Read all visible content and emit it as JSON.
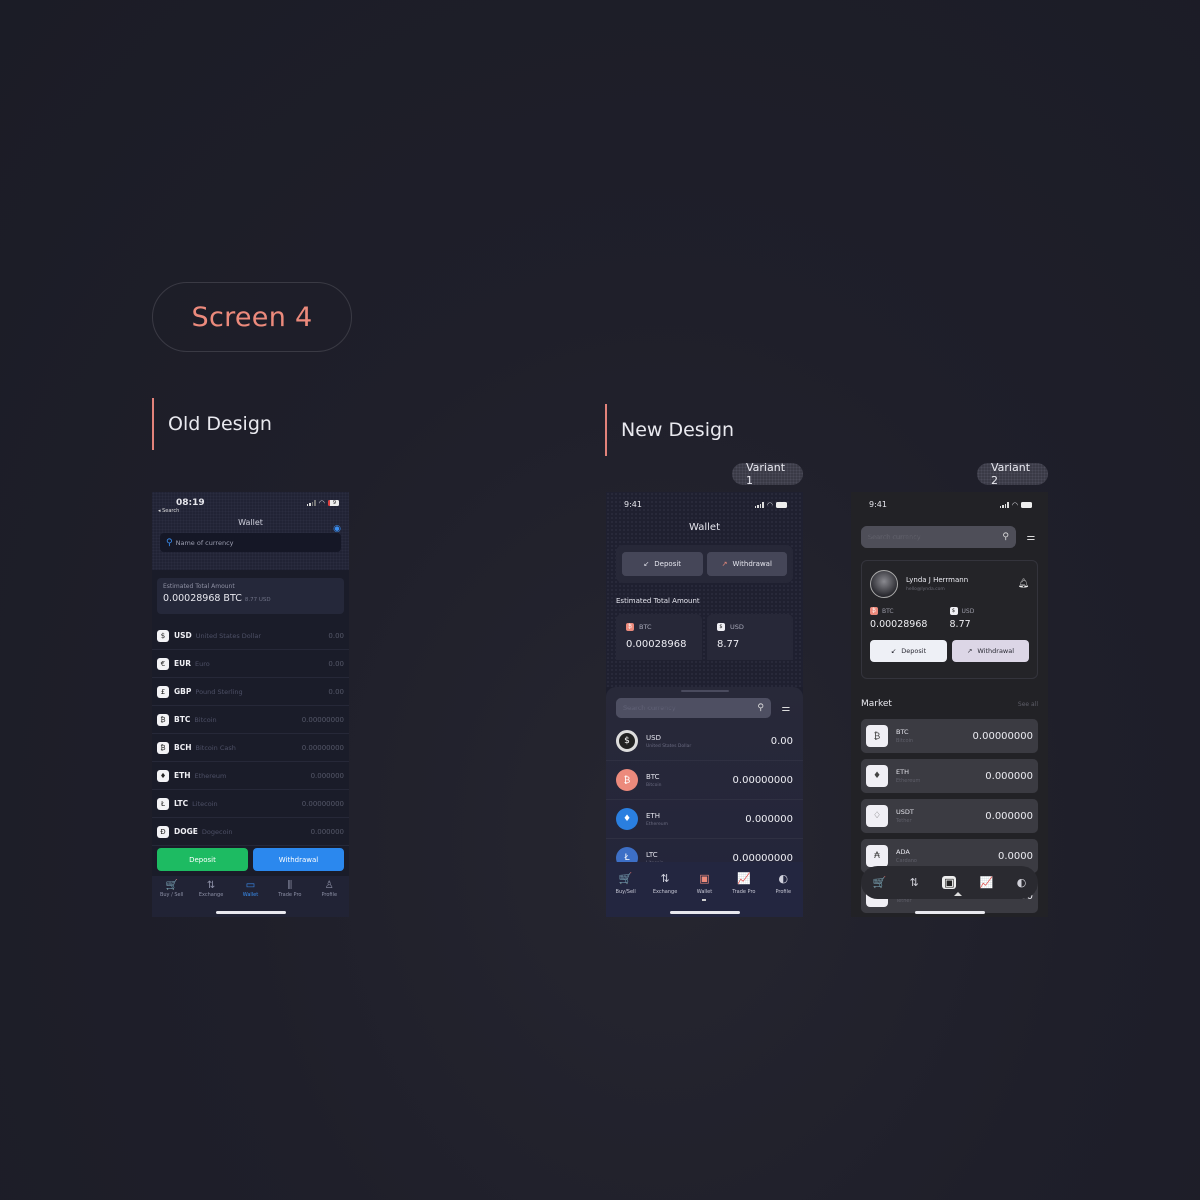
{
  "page": {
    "screen_label": "Screen 4",
    "old_title": "Old Design",
    "new_title": "New Design",
    "variant1_label": "Variant 1",
    "variant2_label": "Variant 2",
    "accent_color": "#ec8a7c"
  },
  "old": {
    "time": "08:19",
    "back_label": "◂ Search",
    "battery": "9",
    "title": "Wallet",
    "search_placeholder": "Name of currency",
    "total_label": "Estimated Total Amount",
    "total_value": "0.00028968 BTC",
    "total_sub": "8.77 USD",
    "currencies": [
      {
        "symbol": "$",
        "code": "USD",
        "name": "United States Dollar",
        "amount": "0.00"
      },
      {
        "symbol": "€",
        "code": "EUR",
        "name": "Euro",
        "amount": "0.00"
      },
      {
        "symbol": "£",
        "code": "GBP",
        "name": "Pound Sterling",
        "amount": "0.00"
      },
      {
        "symbol": "₿",
        "code": "BTC",
        "name": "Bitcoin",
        "amount": "0.00000000"
      },
      {
        "symbol": "₿",
        "code": "BCH",
        "name": "Bitcoin Cash",
        "amount": "0.00000000"
      },
      {
        "symbol": "♦",
        "code": "ETH",
        "name": "Ethereum",
        "amount": "0.000000"
      },
      {
        "symbol": "Ł",
        "code": "LTC",
        "name": "Litecoin",
        "amount": "0.00000000"
      },
      {
        "symbol": "Ð",
        "code": "DOGE",
        "name": "Dogecoin",
        "amount": "0.000000"
      }
    ],
    "deposit_label": "Deposit",
    "withdrawal_label": "Withdrawal",
    "nav": [
      {
        "label": "Buy / Sell",
        "glyph": "🛒"
      },
      {
        "label": "Exchange",
        "glyph": "⇅"
      },
      {
        "label": "Wallet",
        "glyph": "▭"
      },
      {
        "label": "Trade Pro",
        "glyph": "⫼"
      },
      {
        "label": "Profile",
        "glyph": "♙"
      }
    ]
  },
  "v1": {
    "time": "9:41",
    "title": "Wallet",
    "deposit_label": "Deposit",
    "withdrawal_label": "Withdrawal",
    "estimated_label": "Estimated Total Amount",
    "btc_label": "BTC",
    "btc_value": "0.00028968",
    "usd_label": "USD",
    "usd_value": "8.77",
    "search_placeholder": "Search currency",
    "currencies": [
      {
        "symbol": "$",
        "code": "USD",
        "name": "United States Dollar",
        "amount": "0.00"
      },
      {
        "symbol": "₿",
        "code": "BTC",
        "name": "Bitcoin",
        "amount": "0.00000000"
      },
      {
        "symbol": "♦",
        "code": "ETH",
        "name": "Ethereum",
        "amount": "0.000000"
      },
      {
        "symbol": "Ł",
        "code": "LTC",
        "name": "Litecoin",
        "amount": "0.00000000"
      }
    ],
    "nav": [
      {
        "label": "Buy/Sell",
        "glyph": "🛒"
      },
      {
        "label": "Exchange",
        "glyph": "⇅"
      },
      {
        "label": "Wallet",
        "glyph": "▣"
      },
      {
        "label": "Trade Pro",
        "glyph": "📈"
      },
      {
        "label": "Profile",
        "glyph": "◐"
      }
    ]
  },
  "v2": {
    "time": "9:41",
    "search_placeholder": "Search currency",
    "user_name": "Lynda J Herrmann",
    "user_email": "hello@lynda.com",
    "btc_label": "BTC",
    "btc_value": "0.00028968",
    "usd_label": "USD",
    "usd_value": "8.77",
    "deposit_label": "Deposit",
    "withdrawal_label": "Withdrawal",
    "market_title": "Market",
    "see_all": "See all",
    "market": [
      {
        "symbol": "₿",
        "code": "BTC",
        "name": "Bitcoin",
        "amount": "0.00000000"
      },
      {
        "symbol": "♦",
        "code": "ETH",
        "name": "Ethereum",
        "amount": "0.000000"
      },
      {
        "symbol": "♢",
        "code": "USDT",
        "name": "Tether",
        "amount": "0.000000"
      },
      {
        "symbol": "₳",
        "code": "ADA",
        "name": "Cardano",
        "amount": "0.0000"
      },
      {
        "symbol": "♢",
        "code": "USDT",
        "name": "Tether",
        "amount": "0.000000"
      }
    ],
    "nav_glyphs": [
      "🛒",
      "⇅",
      "▣",
      "📈",
      "◐"
    ]
  }
}
